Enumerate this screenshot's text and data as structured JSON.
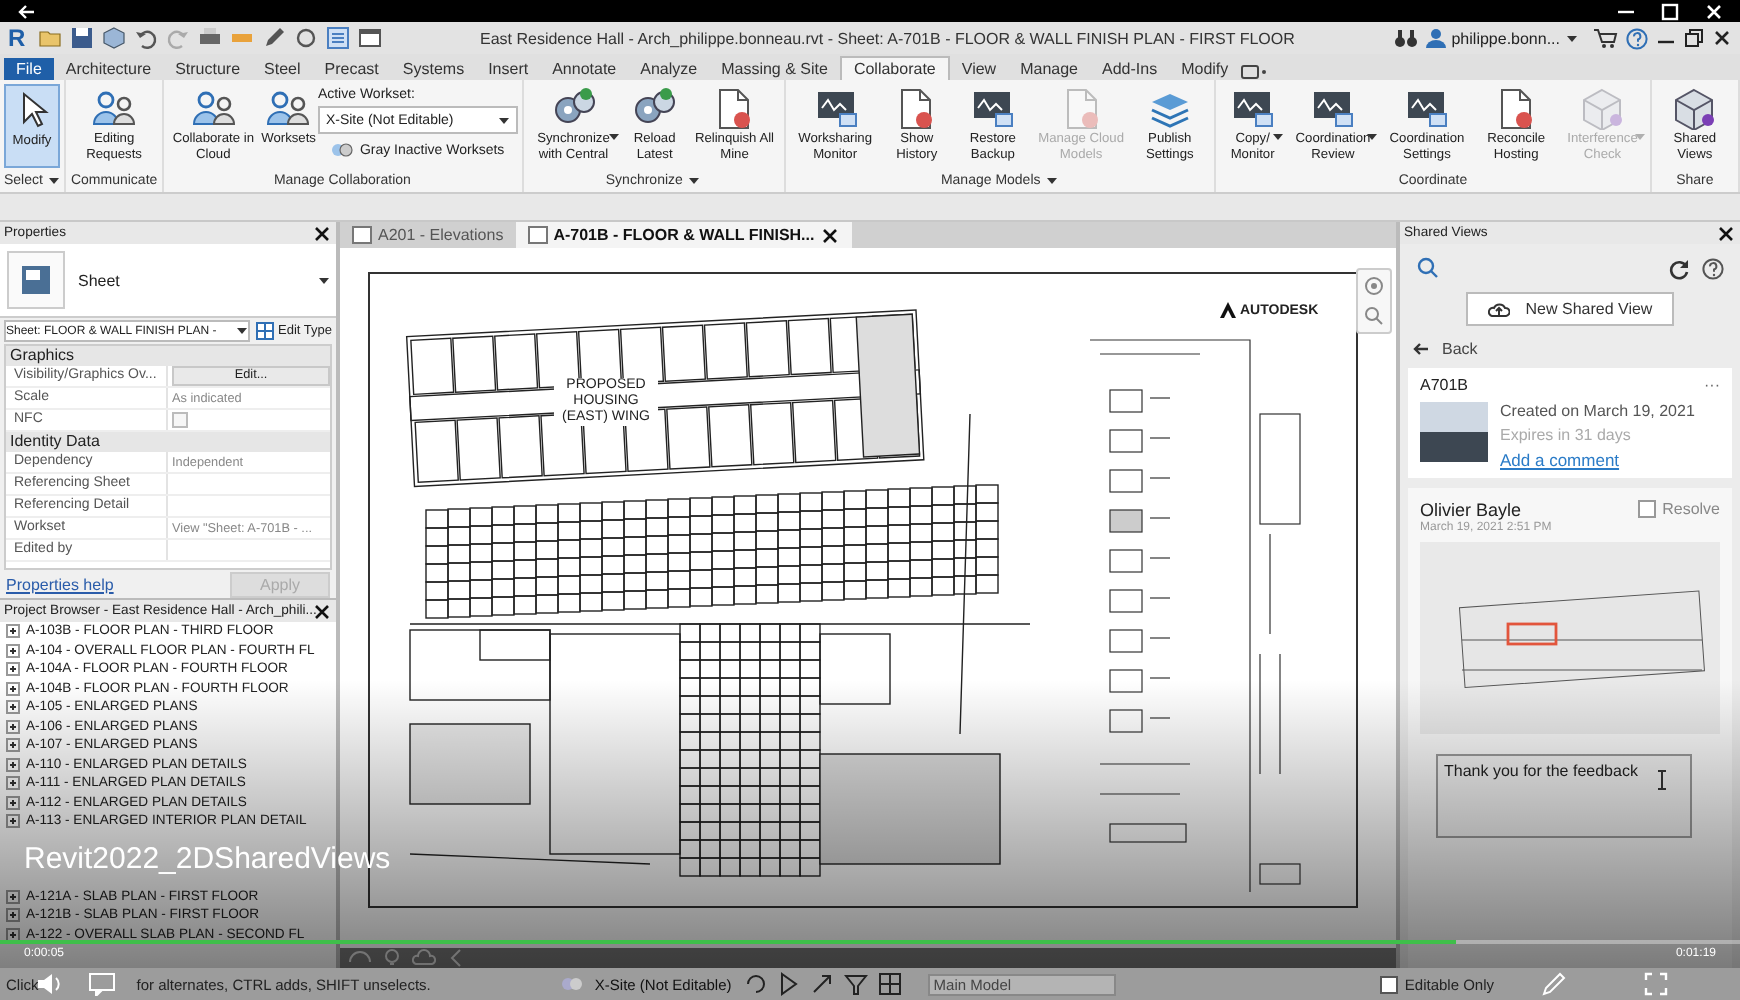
{
  "app": {
    "logo": "R",
    "title": "East Residence Hall - Arch_philippe.bonneau.rvt - Sheet: A-701B - FLOOR & WALL FINISH PLAN - FIRST FLOOR",
    "user": "philippe.bonn..."
  },
  "ribbon_tabs": [
    {
      "label": "File",
      "kind": "file",
      "selected": false
    },
    {
      "label": "Architecture",
      "kind": "tab",
      "selected": false
    },
    {
      "label": "Structure",
      "kind": "tab",
      "selected": false
    },
    {
      "label": "Steel",
      "kind": "tab",
      "selected": false
    },
    {
      "label": "Precast",
      "kind": "tab",
      "selected": false
    },
    {
      "label": "Systems",
      "kind": "tab",
      "selected": false
    },
    {
      "label": "Insert",
      "kind": "tab",
      "selected": false
    },
    {
      "label": "Annotate",
      "kind": "tab",
      "selected": false
    },
    {
      "label": "Analyze",
      "kind": "tab",
      "selected": false
    },
    {
      "label": "Massing & Site",
      "kind": "tab",
      "selected": false
    },
    {
      "label": "Collaborate",
      "kind": "tab",
      "selected": true
    },
    {
      "label": "View",
      "kind": "tab",
      "selected": false
    },
    {
      "label": "Manage",
      "kind": "tab",
      "selected": false
    },
    {
      "label": "Add-Ins",
      "kind": "tab",
      "selected": false
    },
    {
      "label": "Modify",
      "kind": "tab",
      "selected": false
    }
  ],
  "ribbon_panels": [
    {
      "title": "Select",
      "menu": true,
      "buttons": [
        {
          "label": "Modify",
          "active": true,
          "disabled": false,
          "menu": false
        }
      ]
    },
    {
      "title": "Communicate",
      "menu": false,
      "buttons": [
        {
          "label": "Editing Requests",
          "active": false,
          "disabled": false,
          "menu": false
        }
      ]
    },
    {
      "title": "Manage Collaboration",
      "menu": false,
      "buttons": [
        {
          "label": "Collaborate in Cloud",
          "active": false,
          "disabled": false,
          "menu": false
        },
        {
          "label": "Worksets",
          "active": false,
          "disabled": false,
          "menu": false
        }
      ],
      "workset": {
        "label": "Active Workset:",
        "value": "X-Site (Not Editable)",
        "toggle": "Gray Inactive Worksets"
      }
    },
    {
      "title": "Synchronize",
      "menu": true,
      "buttons": [
        {
          "label": "Synchronize with Central",
          "active": false,
          "disabled": false,
          "menu": true
        },
        {
          "label": "Reload Latest",
          "active": false,
          "disabled": false,
          "menu": false
        },
        {
          "label": "Relinquish All Mine",
          "active": false,
          "disabled": false,
          "menu": false
        }
      ]
    },
    {
      "title": "Manage Models",
      "menu": true,
      "buttons": [
        {
          "label": "Worksharing Monitor",
          "active": false,
          "disabled": false,
          "menu": false
        },
        {
          "label": "Show History",
          "active": false,
          "disabled": false,
          "menu": false
        },
        {
          "label": "Restore Backup",
          "active": false,
          "disabled": false,
          "menu": false
        },
        {
          "label": "Manage Cloud Models",
          "active": false,
          "disabled": true,
          "menu": false
        },
        {
          "label": "Publish Settings",
          "active": false,
          "disabled": false,
          "menu": false
        }
      ]
    },
    {
      "title": "Coordinate",
      "menu": false,
      "buttons": [
        {
          "label": "Copy/ Monitor",
          "active": false,
          "disabled": false,
          "menu": true
        },
        {
          "label": "Coordination Review",
          "active": false,
          "disabled": false,
          "menu": true
        },
        {
          "label": "Coordination Settings",
          "active": false,
          "disabled": false,
          "menu": false
        },
        {
          "label": "Reconcile Hosting",
          "active": false,
          "disabled": false,
          "menu": false
        },
        {
          "label": "Interference Check",
          "active": false,
          "disabled": true,
          "menu": true
        }
      ]
    },
    {
      "title": "Share",
      "menu": false,
      "buttons": [
        {
          "label": "Shared Views",
          "active": false,
          "disabled": false,
          "menu": false
        }
      ]
    }
  ],
  "properties": {
    "title": "Properties",
    "type_name": "Sheet",
    "instance": "Sheet: FLOOR & WALL FINISH PLAN -",
    "edit_type": "Edit Type",
    "groups": [
      {
        "name": "Graphics",
        "rows": [
          {
            "label": "Visibility/Graphics Ov...",
            "kind": "button",
            "value": "Edit..."
          },
          {
            "label": "Scale",
            "kind": "text",
            "value": "As indicated"
          },
          {
            "label": "NFC",
            "kind": "checkbox",
            "checked": false
          }
        ]
      },
      {
        "name": "Identity Data",
        "rows": [
          {
            "label": "Dependency",
            "kind": "text",
            "value": "Independent"
          },
          {
            "label": "Referencing Sheet",
            "kind": "text"
          },
          {
            "label": "Referencing Detail",
            "kind": "text"
          },
          {
            "label": "Workset",
            "kind": "text",
            "value": "View \"Sheet: A-701B - ..."
          },
          {
            "label": "Edited by",
            "kind": "text"
          }
        ]
      }
    ],
    "help": "Properties help",
    "apply": "Apply"
  },
  "project_browser": {
    "title": "Project Browser - East Residence Hall - Arch_phili...",
    "items": [
      "A-103B - FLOOR PLAN - THIRD FLOOR",
      "A-104 - OVERALL FLOOR PLAN - FOURTH FL",
      "A-104A - FLOOR PLAN - FOURTH FLOOR",
      "A-104B - FLOOR PLAN - FOURTH FLOOR",
      "A-105 - ENLARGED PLANS",
      "A-106 - ENLARGED PLANS",
      "A-107 - ENLARGED PLANS",
      "A-110 - ENLARGED PLAN DETAILS",
      "A-111 - ENLARGED PLAN DETAILS",
      "A-112 - ENLARGED PLAN DETAILS",
      "A-113 - ENLARGED INTERIOR PLAN DETAIL"
    ],
    "items_below_caption": [
      "A-121A - SLAB PLAN - FIRST FLOOR",
      "A-121B - SLAB PLAN - FIRST FLOOR",
      "A-122 - OVERALL SLAB PLAN - SECOND FL"
    ]
  },
  "view_tabs": [
    {
      "label": "A201 - Elevations",
      "selected": false,
      "closable": false
    },
    {
      "label": "A-701B - FLOOR & WALL FINISH...",
      "selected": true,
      "closable": true
    }
  ],
  "sheet": {
    "logo": "AUTODESK",
    "plan_label": "PROPOSED HOUSING (EAST) WING"
  },
  "shared_views": {
    "title": "Shared Views",
    "new_button": "New Shared View",
    "back": "Back",
    "view": {
      "name": "A701B",
      "more": "···",
      "created": "Created on March 19, 2021",
      "expires": "Expires in 31 days",
      "comment_link": "Add a comment"
    },
    "comment": {
      "author": "Olivier Bayle",
      "time": "March 19, 2021 2:51 PM",
      "resolve": "Resolve",
      "resolved": false,
      "reply": "Thank you for the feedback"
    }
  },
  "status": {
    "hint_start": "Click",
    "hint_end": "for alternates, CTRL adds, SHIFT unselects.",
    "workset": "X-Site (Not Editable)",
    "model": "Main Model",
    "editable_only": "Editable Only",
    "editable_only_checked": false
  },
  "video": {
    "title": "Revit2022_2DSharedViews",
    "elapsed": "0:00:05",
    "duration": "0:01:19",
    "level": 0.837
  }
}
